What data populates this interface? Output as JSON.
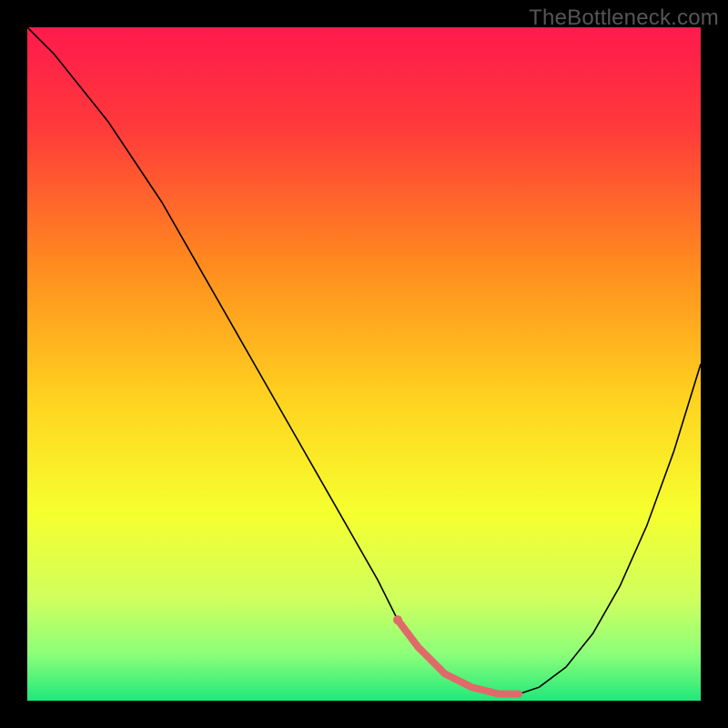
{
  "watermark": "TheBottleneck.com",
  "chart_data": {
    "type": "line",
    "title": "",
    "xlabel": "",
    "ylabel": "",
    "xlim": [
      0,
      100
    ],
    "ylim": [
      0,
      100
    ],
    "background_gradient": {
      "stops": [
        {
          "pos": 0.0,
          "color": "#ff1a4d"
        },
        {
          "pos": 0.15,
          "color": "#ff3a3a"
        },
        {
          "pos": 0.35,
          "color": "#ff8a1f"
        },
        {
          "pos": 0.55,
          "color": "#ffd21f"
        },
        {
          "pos": 0.72,
          "color": "#f6ff2e"
        },
        {
          "pos": 0.85,
          "color": "#cfff5e"
        },
        {
          "pos": 0.93,
          "color": "#8dff7a"
        },
        {
          "pos": 1.0,
          "color": "#20e87a"
        }
      ]
    },
    "series": [
      {
        "name": "bottleneck-curve",
        "stroke": "#000000",
        "stroke_width": 1.6,
        "x": [
          0,
          4,
          8,
          12,
          16,
          20,
          24,
          28,
          32,
          36,
          40,
          44,
          48,
          52,
          55,
          58,
          62,
          66,
          70,
          73,
          76,
          80,
          84,
          88,
          92,
          96,
          100
        ],
        "y": [
          100,
          96,
          91,
          86,
          80,
          74,
          67,
          60,
          53,
          46,
          39,
          32,
          25,
          18,
          12,
          8,
          4,
          2,
          1,
          1,
          2,
          5,
          10,
          17,
          26,
          37,
          50
        ]
      },
      {
        "name": "optimal-range-highlight",
        "stroke": "#e06a6a",
        "stroke_width": 8,
        "linecap": "round",
        "x": [
          55,
          58,
          62,
          66,
          70,
          73
        ],
        "y": [
          12,
          8,
          4,
          2,
          1,
          1
        ]
      }
    ],
    "annotations": [
      {
        "name": "optimal-dot",
        "type": "circle",
        "x": 55,
        "y": 12,
        "r": 5,
        "fill": "#e06a6a"
      }
    ]
  }
}
